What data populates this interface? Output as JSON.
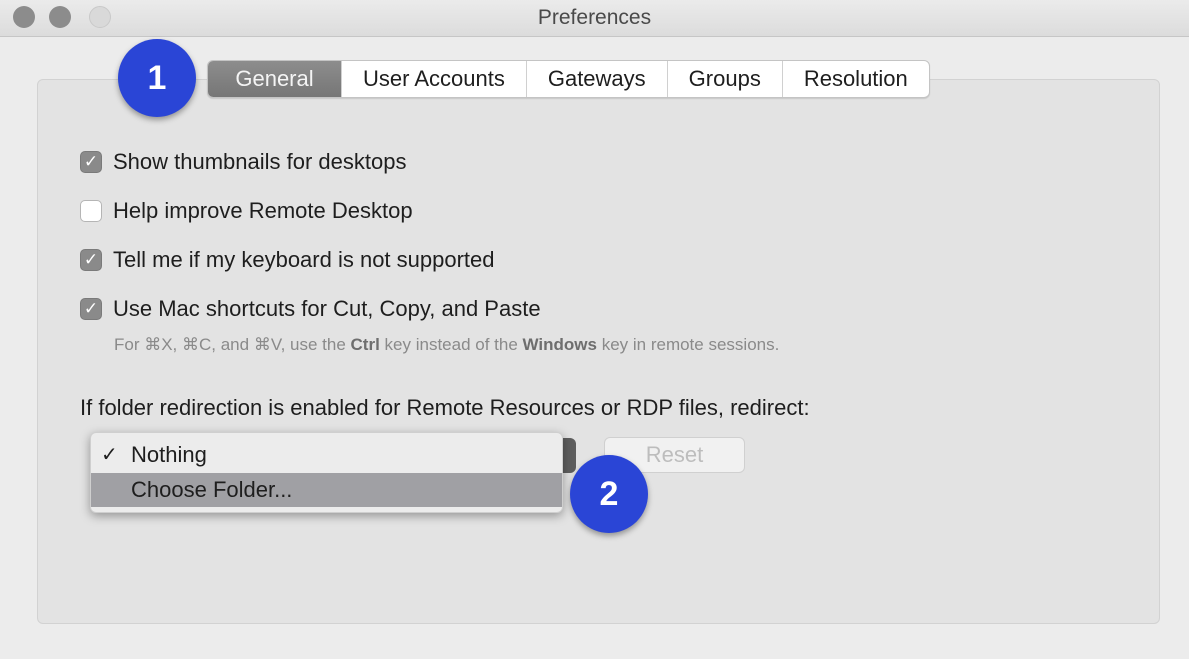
{
  "window": {
    "title": "Preferences"
  },
  "tabs": [
    {
      "label": "General",
      "active": true
    },
    {
      "label": "User Accounts",
      "active": false
    },
    {
      "label": "Gateways",
      "active": false
    },
    {
      "label": "Groups",
      "active": false
    },
    {
      "label": "Resolution",
      "active": false
    }
  ],
  "badges": [
    "1",
    "2"
  ],
  "options": [
    {
      "label": "Show thumbnails for desktops",
      "checked": true
    },
    {
      "label": "Help improve Remote Desktop",
      "checked": false
    },
    {
      "label": "Tell me if my keyboard is not supported",
      "checked": true
    },
    {
      "label": "Use Mac shortcuts for Cut, Copy, and Paste",
      "checked": true
    }
  ],
  "note": {
    "prefix": "For ⌘X, ⌘C, and ⌘V, use the ",
    "key1": "Ctrl",
    "middle": " key instead of the ",
    "key2": "Windows",
    "suffix": " key in remote sessions."
  },
  "redirect": {
    "label": "If folder redirection is enabled for Remote Resources or RDP files, redirect:",
    "menu": [
      {
        "label": "Nothing",
        "checked": true,
        "highlighted": false
      },
      {
        "label": "Choose Folder...",
        "checked": false,
        "highlighted": true
      }
    ],
    "reset_label": "Reset"
  },
  "glyphs": {
    "check": "✓"
  },
  "colors": {
    "badge": "#2a45d6",
    "active_tab": "#808080"
  }
}
